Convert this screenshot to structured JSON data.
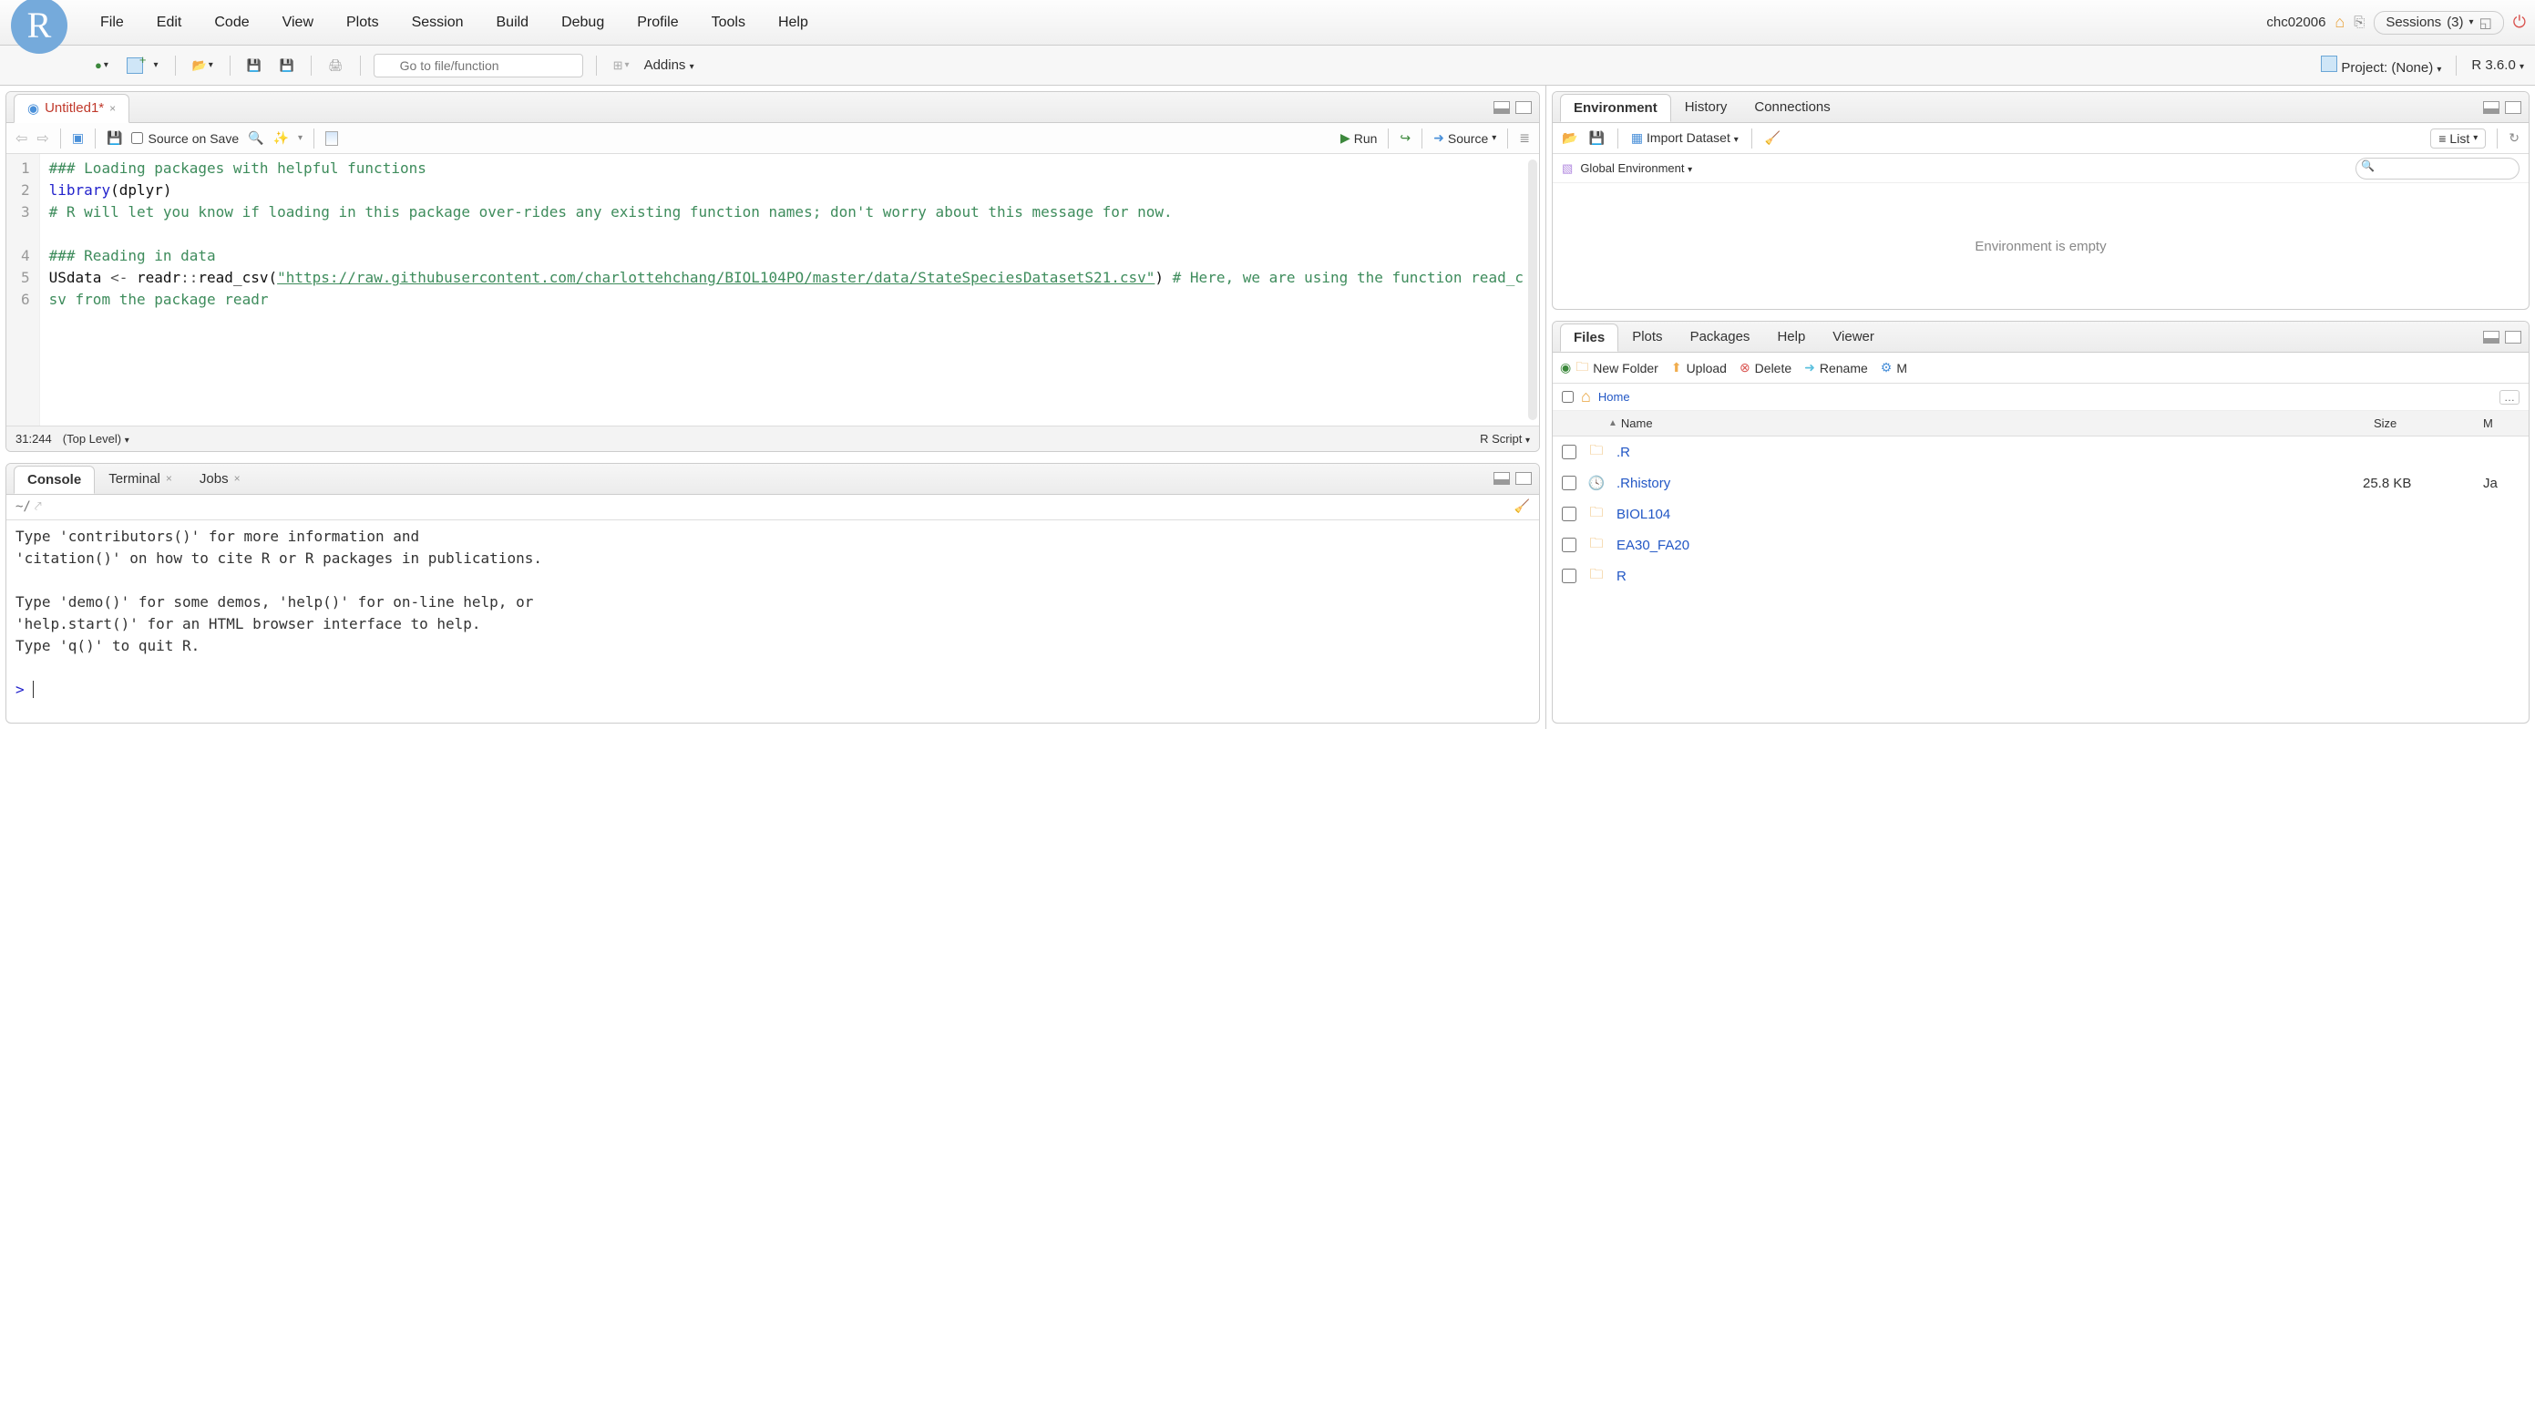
{
  "menubar": [
    "File",
    "Edit",
    "Code",
    "View",
    "Plots",
    "Session",
    "Build",
    "Debug",
    "Profile",
    "Tools",
    "Help"
  ],
  "top_right": {
    "user": "chc02006",
    "sessions_label": "Sessions",
    "sessions_count": "(3)"
  },
  "toolbar2": {
    "goto_placeholder": "Go to file/function",
    "addins": "Addins",
    "project_label": "Project: (None)",
    "r_version": "R 3.6.0"
  },
  "source": {
    "tab_title": "Untitled1*",
    "source_on_save": "Source on Save",
    "run": "Run",
    "source": "Source",
    "lines": [
      {
        "n": "1",
        "cls": "c-comment",
        "t": "### Loading packages with helpful functions"
      },
      {
        "n": "2",
        "cls": "",
        "t": ""
      },
      {
        "n": "3",
        "cls": "c-comment",
        "t": "# R will let you know if loading in this package over-rides any existing function names; don't worry about this message for now."
      },
      {
        "n": "4",
        "cls": "",
        "t": ""
      },
      {
        "n": "5",
        "cls": "c-comment",
        "t": "### Reading in data"
      },
      {
        "n": "6",
        "cls": "",
        "t": ""
      }
    ],
    "line2_kw": "library",
    "line2_arg": "(dplyr)",
    "line6_a": "USdata ",
    "line6_op": "<-",
    "line6_b": " readr",
    "line6_c": "::",
    "line6_d": "read_csv(",
    "line6_str": "\"https://raw.githubusercontent.com/charlottehchang/BIOL104PO/master/data/StateSpeciesDatasetS21.csv\"",
    "line6_e": ") ",
    "line6_cmt": "# Here, we are using the function read_csv from the package readr",
    "status_pos": "31:244",
    "status_scope": "(Top Level)",
    "status_type": "R Script"
  },
  "console": {
    "tabs": [
      "Console",
      "Terminal",
      "Jobs"
    ],
    "path": "~/",
    "body": "Type 'contributors()' for more information and\n'citation()' on how to cite R or R packages in publications.\n\nType 'demo()' for some demos, 'help()' for on-line help, or\n'help.start()' for an HTML browser interface to help.\nType 'q()' to quit R.\n",
    "prompt": "> "
  },
  "env": {
    "tabs": [
      "Environment",
      "History",
      "Connections"
    ],
    "import": "Import Dataset",
    "list": "List",
    "scope": "Global Environment",
    "empty": "Environment is empty"
  },
  "files": {
    "tabs": [
      "Files",
      "Plots",
      "Packages",
      "Help",
      "Viewer"
    ],
    "buttons": {
      "new": "New Folder",
      "upload": "Upload",
      "delete": "Delete",
      "rename": "Rename",
      "more": "M"
    },
    "home": "Home",
    "cols": {
      "name": "Name",
      "size": "Size",
      "mod": "M"
    },
    "rows": [
      {
        "icon": "folder",
        "name": ".R",
        "size": "",
        "mod": ""
      },
      {
        "icon": "file",
        "name": ".Rhistory",
        "size": "25.8 KB",
        "mod": "Ja"
      },
      {
        "icon": "folder",
        "name": "BIOL104",
        "size": "",
        "mod": ""
      },
      {
        "icon": "folder",
        "name": "EA30_FA20",
        "size": "",
        "mod": ""
      },
      {
        "icon": "folder",
        "name": "R",
        "size": "",
        "mod": ""
      }
    ]
  }
}
